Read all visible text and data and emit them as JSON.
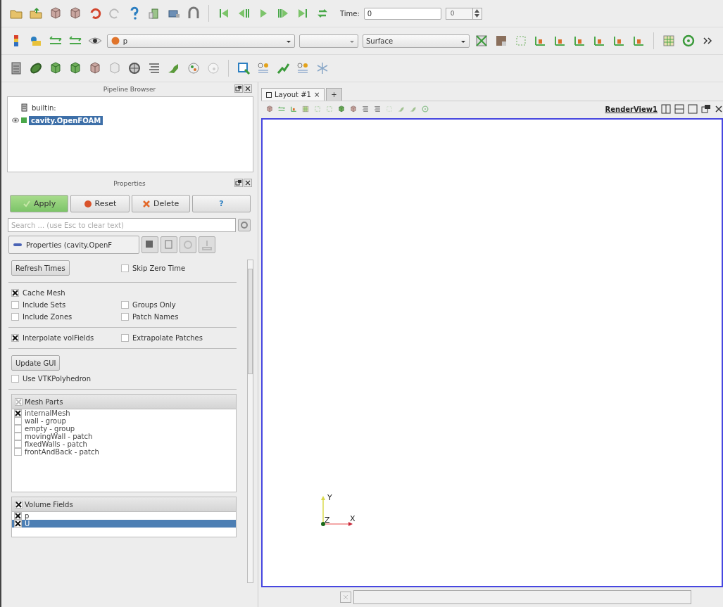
{
  "toolbar": {
    "time_label": "Time:",
    "time_value": "0",
    "time_step": "0",
    "array": {
      "label": "p"
    },
    "representation": {
      "label": "Surface"
    }
  },
  "pipeline_browser": {
    "title": "Pipeline Browser",
    "items": [
      {
        "label": "builtin:",
        "selected": false,
        "visible": false,
        "children": [
          {
            "label": "cavity.OpenFOAM",
            "selected": true,
            "visible": true
          }
        ]
      }
    ]
  },
  "properties": {
    "title": "Properties",
    "buttons": [
      {
        "label": "Apply",
        "kind": "apply"
      },
      {
        "label": "Reset",
        "kind": "reset"
      },
      {
        "label": "Delete",
        "kind": "delete"
      },
      {
        "label": "?",
        "kind": "help"
      }
    ],
    "search": {
      "placeholder": "Search ... (use Esc to clear text)"
    },
    "section": "Properties (cavity.OpenF",
    "groups": [
      {
        "rows": [
          {
            "items": [
              {
                "kind": "button",
                "label": "Refresh Times"
              },
              {
                "kind": "checkbox",
                "label": "Skip Zero Time",
                "checked": false
              }
            ]
          }
        ]
      },
      {
        "rows": [
          {
            "items": [
              {
                "kind": "checkbox",
                "label": "Cache Mesh",
                "checked": true
              }
            ]
          },
          {
            "items": [
              {
                "kind": "checkbox",
                "label": "Include Sets",
                "checked": false
              },
              {
                "kind": "checkbox",
                "label": "Groups Only",
                "checked": false
              }
            ]
          },
          {
            "items": [
              {
                "kind": "checkbox",
                "label": "Include Zones",
                "checked": false
              },
              {
                "kind": "checkbox",
                "label": "Patch Names",
                "checked": false
              }
            ]
          }
        ]
      },
      {
        "rows": [
          {
            "items": [
              {
                "kind": "checkbox",
                "label": "Interpolate volFields",
                "checked": true
              },
              {
                "kind": "checkbox",
                "label": "Extrapolate Patches",
                "checked": false
              }
            ]
          }
        ]
      },
      {
        "rows": [
          {
            "items": [
              {
                "kind": "button",
                "label": "Update GUI"
              }
            ]
          },
          {
            "items": [
              {
                "kind": "checkbox",
                "label": "Use VTKPolyhedron",
                "checked": false
              }
            ]
          }
        ]
      }
    ],
    "lists": [
      {
        "title": "Mesh Parts",
        "checked": false,
        "partial": true,
        "items": [
          {
            "label": "internalMesh",
            "checked": true,
            "selected": false
          },
          {
            "label": "wall - group",
            "checked": false,
            "selected": false
          },
          {
            "label": "empty - group",
            "checked": false,
            "selected": false
          },
          {
            "label": "movingWall - patch",
            "checked": false,
            "selected": false
          },
          {
            "label": "fixedWalls - patch",
            "checked": false,
            "selected": false
          },
          {
            "label": "frontAndBack - patch",
            "checked": false,
            "selected": false
          }
        ]
      },
      {
        "title": "Volume Fields",
        "checked": true,
        "items": [
          {
            "label": "p",
            "checked": true,
            "selected": false
          },
          {
            "label": "U",
            "checked": true,
            "selected": true
          }
        ]
      }
    ]
  },
  "layout_tabs": [
    {
      "label": "Layout #1",
      "close": "×",
      "selected": true
    },
    {
      "label": "+",
      "selected": false
    }
  ],
  "render_view": {
    "title": "RenderView1",
    "axes": {
      "x": "X",
      "y": "Y",
      "z": "Z"
    }
  }
}
